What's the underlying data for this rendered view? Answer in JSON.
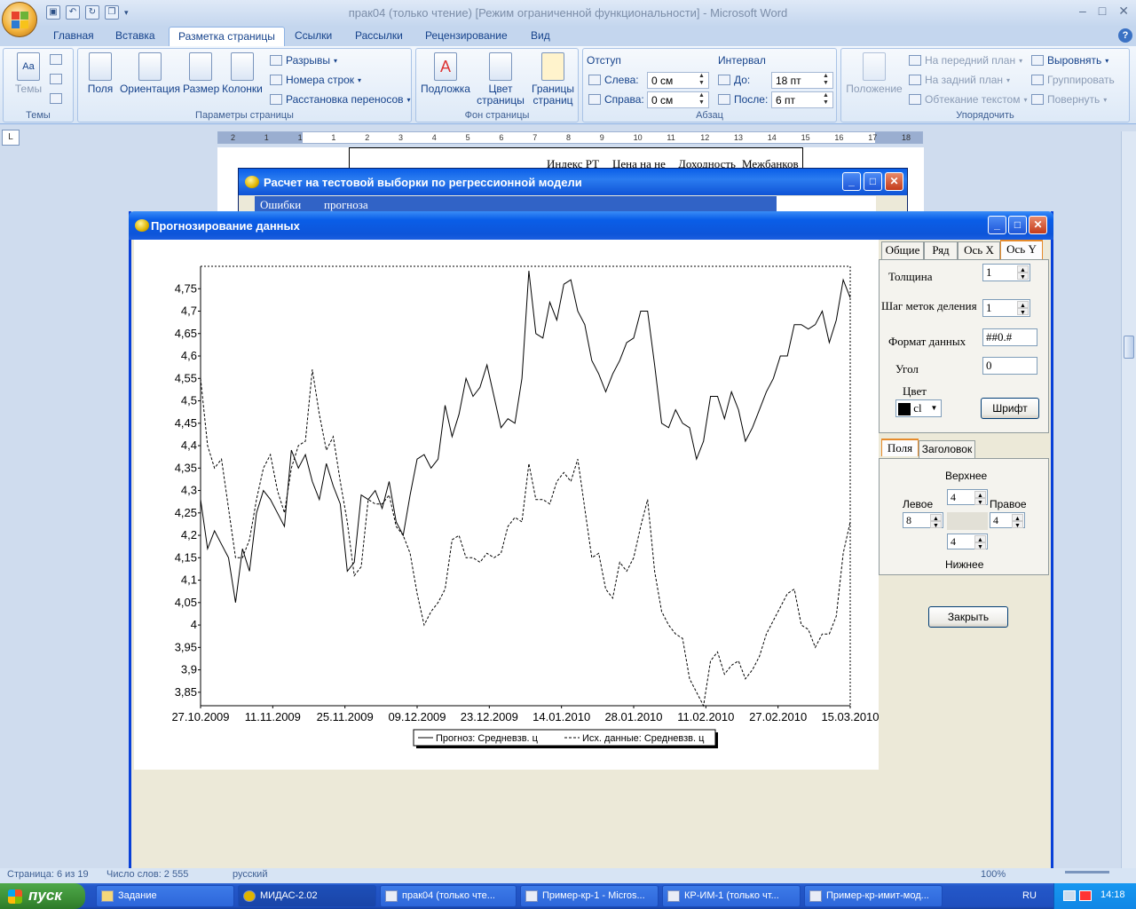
{
  "word": {
    "title": "прак04 (только чтение) [Режим ограниченной функциональности] - Microsoft Word",
    "tabs": [
      "Главная",
      "Вставка",
      "Разметка страницы",
      "Ссылки",
      "Рассылки",
      "Рецензирование",
      "Вид"
    ],
    "active_tab": "Разметка страницы",
    "ribbon": {
      "themes": {
        "label": "Темы",
        "button": "Темы"
      },
      "page_setup": {
        "label": "Параметры страницы",
        "fields": "Поля",
        "orientation": "Ориентация",
        "size": "Размер",
        "columns": "Колонки",
        "breaks": "Разрывы",
        "line_numbers": "Номера строк",
        "hyphenation": "Расстановка переносов"
      },
      "background": {
        "label": "Фон страницы",
        "watermark": "Подложка",
        "color_l1": "Цвет",
        "color_l2": "страницы",
        "borders_l1": "Границы",
        "borders_l2": "страниц"
      },
      "paragraph": {
        "label": "Абзац",
        "indent": "Отступ",
        "left": "Слева:",
        "right": "Справа:",
        "left_val": "0 см",
        "right_val": "0 см",
        "spacing": "Интервал",
        "before": "До:",
        "after": "После:",
        "before_val": "18 пт",
        "after_val": "6 пт"
      },
      "arrange": {
        "label": "Упорядочить",
        "position": "Положение",
        "front": "На передний план",
        "back": "На задний план",
        "wrap": "Обтекание текстом",
        "align": "Выровнять",
        "group": "Группировать",
        "rotate": "Повернуть"
      }
    },
    "ruler_numbers": [
      "2",
      "1",
      "1",
      "1",
      "2",
      "3",
      "4",
      "5",
      "6",
      "7",
      "8",
      "9",
      "10",
      "11",
      "12",
      "13",
      "14",
      "15",
      "16",
      "17",
      "18"
    ],
    "doc_table_cells": [
      "Индекс РТ",
      "Цена на не",
      "Доходность",
      "Межбанков"
    ],
    "status": {
      "page": "Страница: 6 из 19",
      "words": "Число слов: 2 555",
      "lang": "русский",
      "zoom": "100%"
    }
  },
  "win2": {
    "title": "Расчет на тестовой выборки по регрессионной модели",
    "cells": [
      "Ошибки",
      "прогноза"
    ]
  },
  "main": {
    "title": "Прогнозирование данных",
    "tabs": [
      "Общие",
      "Ряд",
      "Ось X",
      "Ось Y"
    ],
    "active_tab": "Ось Y",
    "axis_y": {
      "thickness_label": "Толщина",
      "thickness": "1",
      "step_label": "Шаг меток деления",
      "step": "1",
      "format_label": "Формат данных",
      "format": "##0.#",
      "angle_label": "Угол",
      "angle": "0",
      "color_label": "Цвет",
      "color_value": "cl",
      "font_button": "Шрифт"
    },
    "margin_tabs": [
      "Поля",
      "Заголовок"
    ],
    "margins": {
      "top_label": "Верхнее",
      "left_label": "Левое",
      "right_label": "Правое",
      "bottom_label": "Нижнее",
      "top": "4",
      "left": "8",
      "right": "4",
      "bottom": "4"
    },
    "close_button": "Закрыть"
  },
  "chart_data": {
    "type": "line",
    "ylim": [
      3.82,
      4.8
    ],
    "yticks": [
      "3,85",
      "3,9",
      "3,95",
      "4",
      "4,05",
      "4,1",
      "4,15",
      "4,2",
      "4,25",
      "4,3",
      "4,35",
      "4,4",
      "4,45",
      "4,5",
      "4,55",
      "4,6",
      "4,65",
      "4,7",
      "4,75"
    ],
    "yticks_values": [
      3.85,
      3.9,
      3.95,
      4.0,
      4.05,
      4.1,
      4.15,
      4.2,
      4.25,
      4.3,
      4.35,
      4.4,
      4.45,
      4.5,
      4.55,
      4.6,
      4.65,
      4.7,
      4.75
    ],
    "xticks": [
      "27.10.2009",
      "11.11.2009",
      "25.11.2009",
      "09.12.2009",
      "23.12.2009",
      "14.01.2010",
      "28.01.2010",
      "11.02.2010",
      "27.02.2010",
      "15.03.2010"
    ],
    "series": [
      {
        "name": "Прогноз: Средневзв. ц",
        "style": "solid",
        "values": [
          4.28,
          4.17,
          4.21,
          4.18,
          4.15,
          4.05,
          4.17,
          4.12,
          4.25,
          4.3,
          4.28,
          4.25,
          4.22,
          4.39,
          4.35,
          4.38,
          4.32,
          4.28,
          4.36,
          4.31,
          4.27,
          4.12,
          4.14,
          4.29,
          4.28,
          4.3,
          4.26,
          4.32,
          4.23,
          4.2,
          4.29,
          4.37,
          4.38,
          4.35,
          4.37,
          4.49,
          4.42,
          4.47,
          4.55,
          4.51,
          4.53,
          4.58,
          4.51,
          4.44,
          4.46,
          4.45,
          4.55,
          4.79,
          4.65,
          4.64,
          4.72,
          4.68,
          4.76,
          4.77,
          4.7,
          4.67,
          4.59,
          4.56,
          4.52,
          4.56,
          4.59,
          4.63,
          4.64,
          4.7,
          4.7,
          4.58,
          4.45,
          4.44,
          4.48,
          4.45,
          4.44,
          4.37,
          4.41,
          4.51,
          4.51,
          4.46,
          4.52,
          4.48,
          4.41,
          4.44,
          4.48,
          4.52,
          4.55,
          4.6,
          4.6,
          4.67,
          4.67,
          4.66,
          4.67,
          4.7,
          4.63,
          4.68,
          4.77,
          4.73
        ]
      },
      {
        "name": "Исх. данные: Средневзв. ц",
        "style": "dashed",
        "values": [
          4.55,
          4.4,
          4.35,
          4.37,
          4.26,
          4.15,
          4.15,
          4.19,
          4.28,
          4.35,
          4.38,
          4.3,
          4.25,
          4.35,
          4.4,
          4.41,
          4.57,
          4.47,
          4.39,
          4.42,
          4.32,
          4.23,
          4.11,
          4.13,
          4.28,
          4.27,
          4.27,
          4.29,
          4.22,
          4.2,
          4.16,
          4.07,
          4.0,
          4.03,
          4.05,
          4.08,
          4.19,
          4.2,
          4.15,
          4.15,
          4.14,
          4.16,
          4.15,
          4.16,
          4.22,
          4.24,
          4.23,
          4.36,
          4.28,
          4.28,
          4.27,
          4.32,
          4.34,
          4.32,
          4.37,
          4.26,
          4.15,
          4.16,
          4.08,
          4.06,
          4.14,
          4.12,
          4.15,
          4.22,
          4.28,
          4.12,
          4.03,
          4.0,
          3.98,
          3.97,
          3.88,
          3.85,
          3.82,
          3.92,
          3.94,
          3.89,
          3.91,
          3.92,
          3.88,
          3.9,
          3.93,
          3.98,
          4.01,
          4.04,
          4.07,
          4.08,
          4.0,
          3.99,
          3.95,
          3.98,
          3.98,
          4.02,
          4.16,
          4.23
        ]
      }
    ],
    "legend_position": "bottom-center",
    "grid": false
  },
  "taskbar": {
    "start": "пуск",
    "items": [
      "Задание",
      "МИДАС-2.02",
      "прак04 (только чте...",
      "Пример-кр-1 - Micros...",
      "КР-ИМ-1 (только чт...",
      "Пример-кр-имит-мод..."
    ],
    "lang": "RU",
    "clock": "14:18"
  }
}
